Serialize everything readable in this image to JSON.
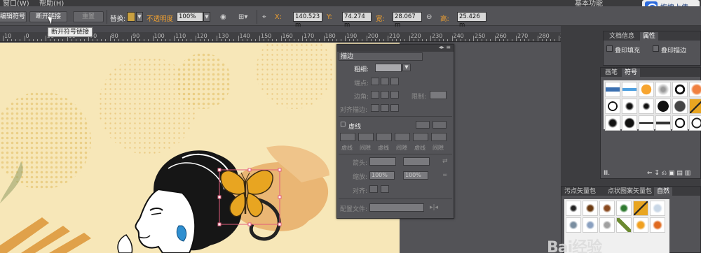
{
  "menu": {
    "items": [
      "窗口(W)",
      "帮助(H)"
    ],
    "right_text": "基本功能"
  },
  "upload": {
    "label": "拖拽上传"
  },
  "control_bar": {
    "edit_symbol": "编辑符号",
    "break_link": "断开链接",
    "reset": "重置",
    "replace_label": "替换:",
    "opacity_label": "不透明度",
    "opacity_value": "100%",
    "x_label": "X:",
    "x_value": "140.523 m",
    "y_label": "Y:",
    "y_value": "74.274 m",
    "w_label": "宽:",
    "w_value": "28.067 m",
    "h_label": "高:",
    "h_value": "25.426 m"
  },
  "tooltip": {
    "text": "断开符号链接"
  },
  "ruler": {
    "labels": [
      "10",
      "0",
      "50",
      "60",
      "70",
      "80",
      "90",
      "100",
      "110",
      "120",
      "130",
      "140",
      "150",
      "160",
      "170",
      "180",
      "190",
      "200",
      "210",
      "220",
      "230",
      "240",
      "250",
      "260",
      "270",
      "280",
      "290"
    ]
  },
  "stroke_panel": {
    "title": "描边",
    "weight_label": "粗细:",
    "cap_label": "端点:",
    "corner_label": "边角:",
    "limit_label": "限制:",
    "align_label": "对齐描边:",
    "dashed_label": "虚线",
    "dash_labels": [
      "虚线",
      "间隙",
      "虚线",
      "间隙",
      "虚线",
      "间隙"
    ],
    "arrow_label": "箭头:",
    "scale_label": "缩放:",
    "scale_value_1": "100%",
    "scale_value_2": "100%",
    "align2_label": "对齐:",
    "profile_label": "配置文件:"
  },
  "doc_panel": {
    "tabs": [
      "文档信息",
      "属性"
    ],
    "overprint_fill": "叠印填充",
    "overprint_stroke": "叠印描边"
  },
  "symbol_panel": {
    "tabs": [
      "画笔",
      "符号"
    ]
  },
  "library_panel": {
    "tabs": [
      "污点矢量包",
      "点状图案矢量包",
      "自然"
    ]
  },
  "watermark": {
    "text": "Bai经验"
  },
  "colors": {
    "accent": "#f0a030",
    "canvas": "#f7e7b8",
    "butterfly": "#e8a521",
    "splash": "#eab674"
  }
}
